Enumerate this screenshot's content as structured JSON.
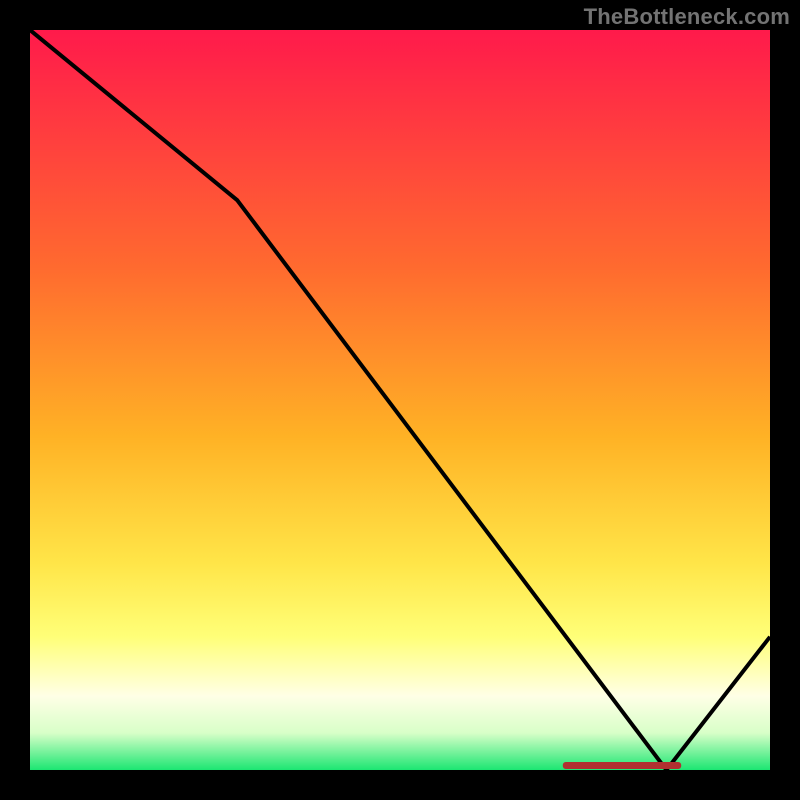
{
  "watermark": "TheBottleneck.com",
  "colors": {
    "frame": "#000000",
    "line": "#000000",
    "watermark": "#737373",
    "bottom_label_fill": "#b03030",
    "gradient_stops": [
      {
        "offset": 0.0,
        "color": "#ff1a4b"
      },
      {
        "offset": 0.32,
        "color": "#ff6a2f"
      },
      {
        "offset": 0.55,
        "color": "#ffb225"
      },
      {
        "offset": 0.72,
        "color": "#ffe548"
      },
      {
        "offset": 0.82,
        "color": "#ffff78"
      },
      {
        "offset": 0.9,
        "color": "#ffffe6"
      },
      {
        "offset": 0.95,
        "color": "#d8ffc8"
      },
      {
        "offset": 1.0,
        "color": "#1ce672"
      }
    ]
  },
  "chart_data": {
    "type": "line",
    "title": "",
    "xlabel": "",
    "ylabel": "",
    "xlim": [
      0,
      100
    ],
    "ylim": [
      0,
      100
    ],
    "categories": [
      0,
      28,
      86,
      100
    ],
    "series": [
      {
        "name": "curve",
        "values": [
          100,
          77,
          0,
          18
        ]
      }
    ],
    "annotations": [
      {
        "name": "bottom-marker",
        "x_range": [
          72,
          88
        ],
        "y": 0
      }
    ]
  }
}
